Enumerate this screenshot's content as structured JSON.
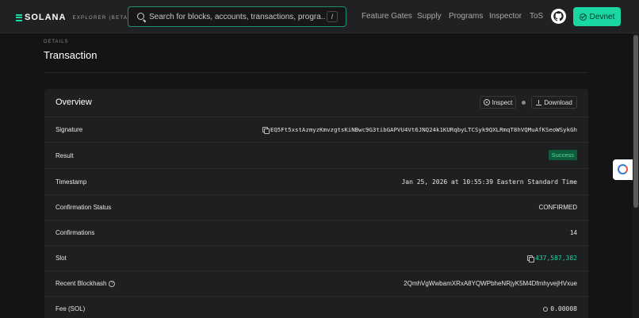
{
  "navbar": {
    "logo_text": "SOLANA",
    "logo_sub": "EXPLORER (BETA)",
    "search_placeholder": "Search for blocks, accounts, transactions, progra...",
    "search_shortcut": "/",
    "links": [
      "Feature Gates",
      "Supply",
      "Programs",
      "Inspector",
      "ToS"
    ],
    "github_icon": "github-icon",
    "cluster_button": "Devnet"
  },
  "header": {
    "eyebrow": "DETAILS",
    "title": "Transaction"
  },
  "overview": {
    "title": "Overview",
    "inspect_label": "Inspect",
    "download_label": "Download",
    "rows": [
      {
        "label": "Signature",
        "value": "EQ5Ft5xstAzmyzKmvzgtsKiNBwc9G3tibGAPVU4Vt6JNQ24k1KURqbyLTCSyk9QXLRmqT8hVQMuAfKSeoWSykGh"
      },
      {
        "label": "Result",
        "value": "Success"
      },
      {
        "label": "Timestamp",
        "value": "Jan 25, 2026 at 10:55:39 Eastern Standard Time"
      },
      {
        "label": "Confirmation Status",
        "value": "CONFIRMED"
      },
      {
        "label": "Confirmations",
        "value": "14"
      },
      {
        "label": "Slot",
        "value": "437,587,382"
      },
      {
        "label": "Recent Blockhash",
        "value": "2QmhVgWwbamXRxA8YQWPbheNRjyK5M4DfmhyvejHVxue"
      },
      {
        "label": "Fee (SOL)",
        "value": "0.00008"
      }
    ]
  },
  "colors": {
    "accent": "#19d6a3",
    "success_bg": "#0f5c3c",
    "success_text": "#3ee29a",
    "background": "#141414",
    "card": "#1e1f20"
  }
}
